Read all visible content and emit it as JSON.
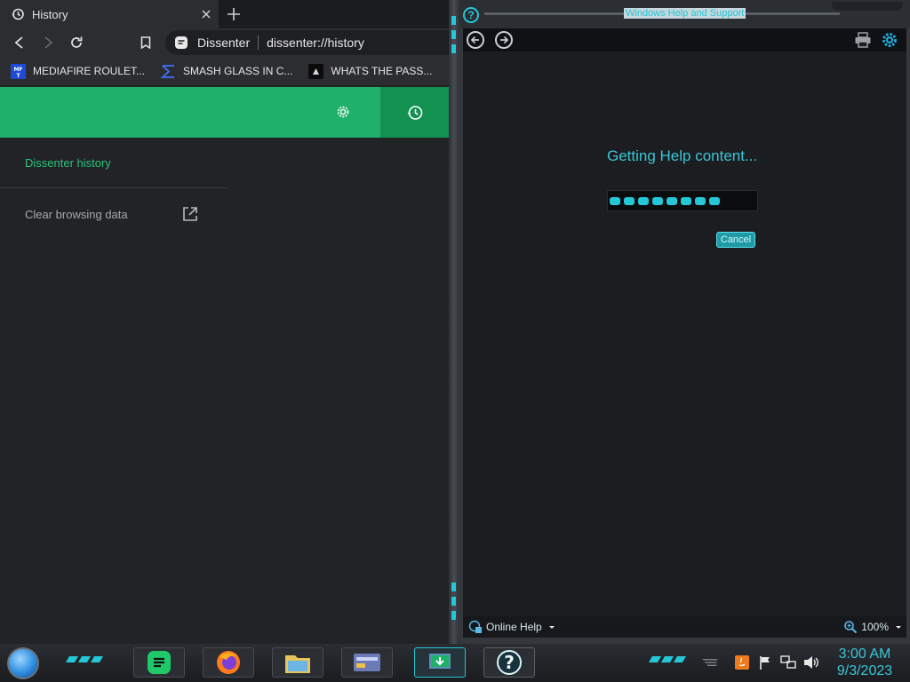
{
  "browser": {
    "tab": {
      "title": "History"
    },
    "omnibox": {
      "site_name": "Dissenter",
      "url": "dissenter://history"
    },
    "bookmarks": [
      {
        "label": "MEDIAFIRE ROULET...",
        "icon": "mediafire-icon"
      },
      {
        "label": "SMASH GLASS IN C...",
        "icon": "sigma-icon"
      },
      {
        "label": "WHATS THE PASS...",
        "icon": "site-icon"
      }
    ],
    "page": {
      "heading": "Dissenter history",
      "clear_label": "Clear browsing data"
    }
  },
  "help_window": {
    "title": "Windows Help and Support",
    "loading_text": "Getting Help content...",
    "progress": {
      "filled_segments": 8,
      "total_segments": 10
    },
    "cancel_label": "Cancel",
    "online_help_label": "Online Help",
    "zoom_label": "100%"
  },
  "taskbar": {
    "clock_time": "3:00 AM",
    "clock_date": "9/3/2023",
    "apps": [
      "spotify-icon",
      "firefox-icon",
      "explorer-icon",
      "control-panel-icon",
      "active-app-icon",
      "help-icon"
    ]
  },
  "colors": {
    "accent_green": "#1fb06a",
    "accent_cyan": "#25c6d6",
    "background_dark": "#212327"
  }
}
